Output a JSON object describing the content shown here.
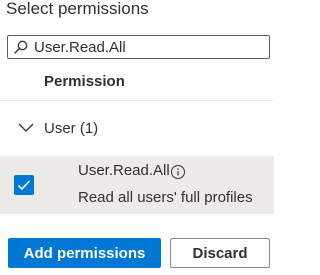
{
  "title": "Select permissions",
  "search": {
    "value": "User.Read.All",
    "icon": "search-icon"
  },
  "table": {
    "column_header": "Permission"
  },
  "group": {
    "label": "User (1)",
    "expanded": true,
    "icon": "chevron-down-icon"
  },
  "permissions": [
    {
      "name": "User.Read.All",
      "description": "Read all users' full profiles",
      "checked": true,
      "info_icon": "info-icon"
    }
  ],
  "buttons": {
    "add_label": "Add permissions",
    "discard_label": "Discard"
  },
  "colors": {
    "accent": "#0078d4",
    "row_selected_bg": "#edebe9",
    "text": "#323130"
  }
}
